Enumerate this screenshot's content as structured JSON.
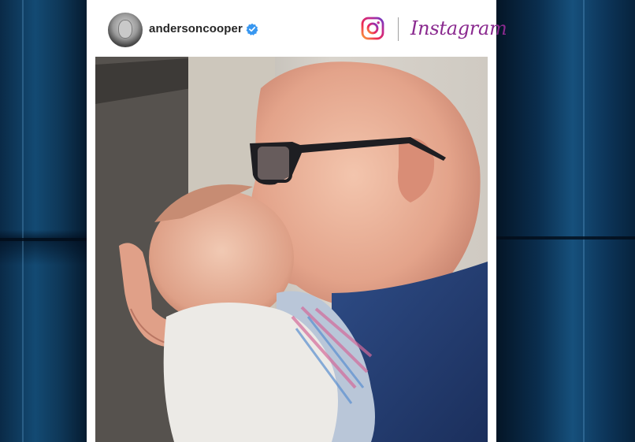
{
  "post": {
    "username": "andersoncooper",
    "brand_wordmark": "Instagram",
    "verified": true
  },
  "icons": {
    "avatar": "profile-photo",
    "verified": "verified-badge-icon",
    "instagram": "instagram-camera-icon"
  },
  "colors": {
    "backdrop": "#0b2f52",
    "verified_badge": "#3897f0",
    "wordmark": "#8a2a8f"
  }
}
